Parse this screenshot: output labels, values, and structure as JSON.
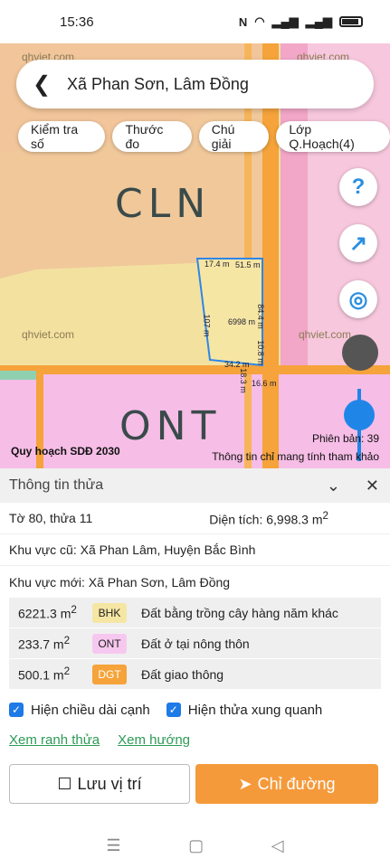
{
  "status": {
    "time": "15:36"
  },
  "search": {
    "location": "Xã Phan Sơn, Lâm Đồng"
  },
  "chips": [
    "Kiểm tra số",
    "Thước đo",
    "Chú giải",
    "Lớp Q.Hoạch(4)"
  ],
  "map": {
    "zone_top": "CLN",
    "zone_bottom": "ONT",
    "watermarks": [
      "qhviet.com",
      "qhviet.com",
      "qhviet.com",
      "qhviet.com"
    ],
    "dimensions": [
      "17.4 m",
      "51.5 m",
      "6998 m",
      "107 m",
      "84.4 m",
      "10.8 m",
      "34.2 m",
      "18.3 m",
      "16.6 m"
    ],
    "caption_left": "Quy hoạch SDĐ 2030",
    "caption_right": "Thông tin chỉ mang tính tham khảo",
    "version": "Phiên bản: 39",
    "colors": {
      "cln": "#f2c896",
      "ont": "#f6bde6",
      "dgt": "#f5a33a",
      "bhk": "#f3e1a0",
      "parcel": "#2f86e8"
    }
  },
  "panel": {
    "title": "Thông tin thửa",
    "parcel": "Tờ 80, thửa 11",
    "area_label": "Diện tích: 6,998.3 m",
    "area_sup": "2",
    "old_area": "Khu vực cũ: Xã Phan Lâm, Huyện Bắc Bình",
    "new_area": "Khu vực mới: Xã Phan Sơn, Lâm Đồng",
    "land_use": [
      {
        "area": "6221.3 m",
        "sup": "2",
        "code": "BHK",
        "desc": "Đất bằng trồng cây hàng năm khác",
        "color": "#f6e6a4"
      },
      {
        "area": "233.7 m",
        "sup": "2",
        "code": "ONT",
        "desc": "Đất ở tại nông thôn",
        "color": "#f7c8ef"
      },
      {
        "area": "500.1 m",
        "sup": "2",
        "code": "DGT",
        "desc": "Đất giao thông",
        "color": "#f5a33a"
      }
    ],
    "check1": "Hiện chiều dài cạnh",
    "check2": "Hiện thửa xung quanh",
    "link1": "Xem ranh thửa",
    "link2": "Xem hướng",
    "save_btn": "Lưu vị trí",
    "dir_btn": "Chỉ đường"
  }
}
